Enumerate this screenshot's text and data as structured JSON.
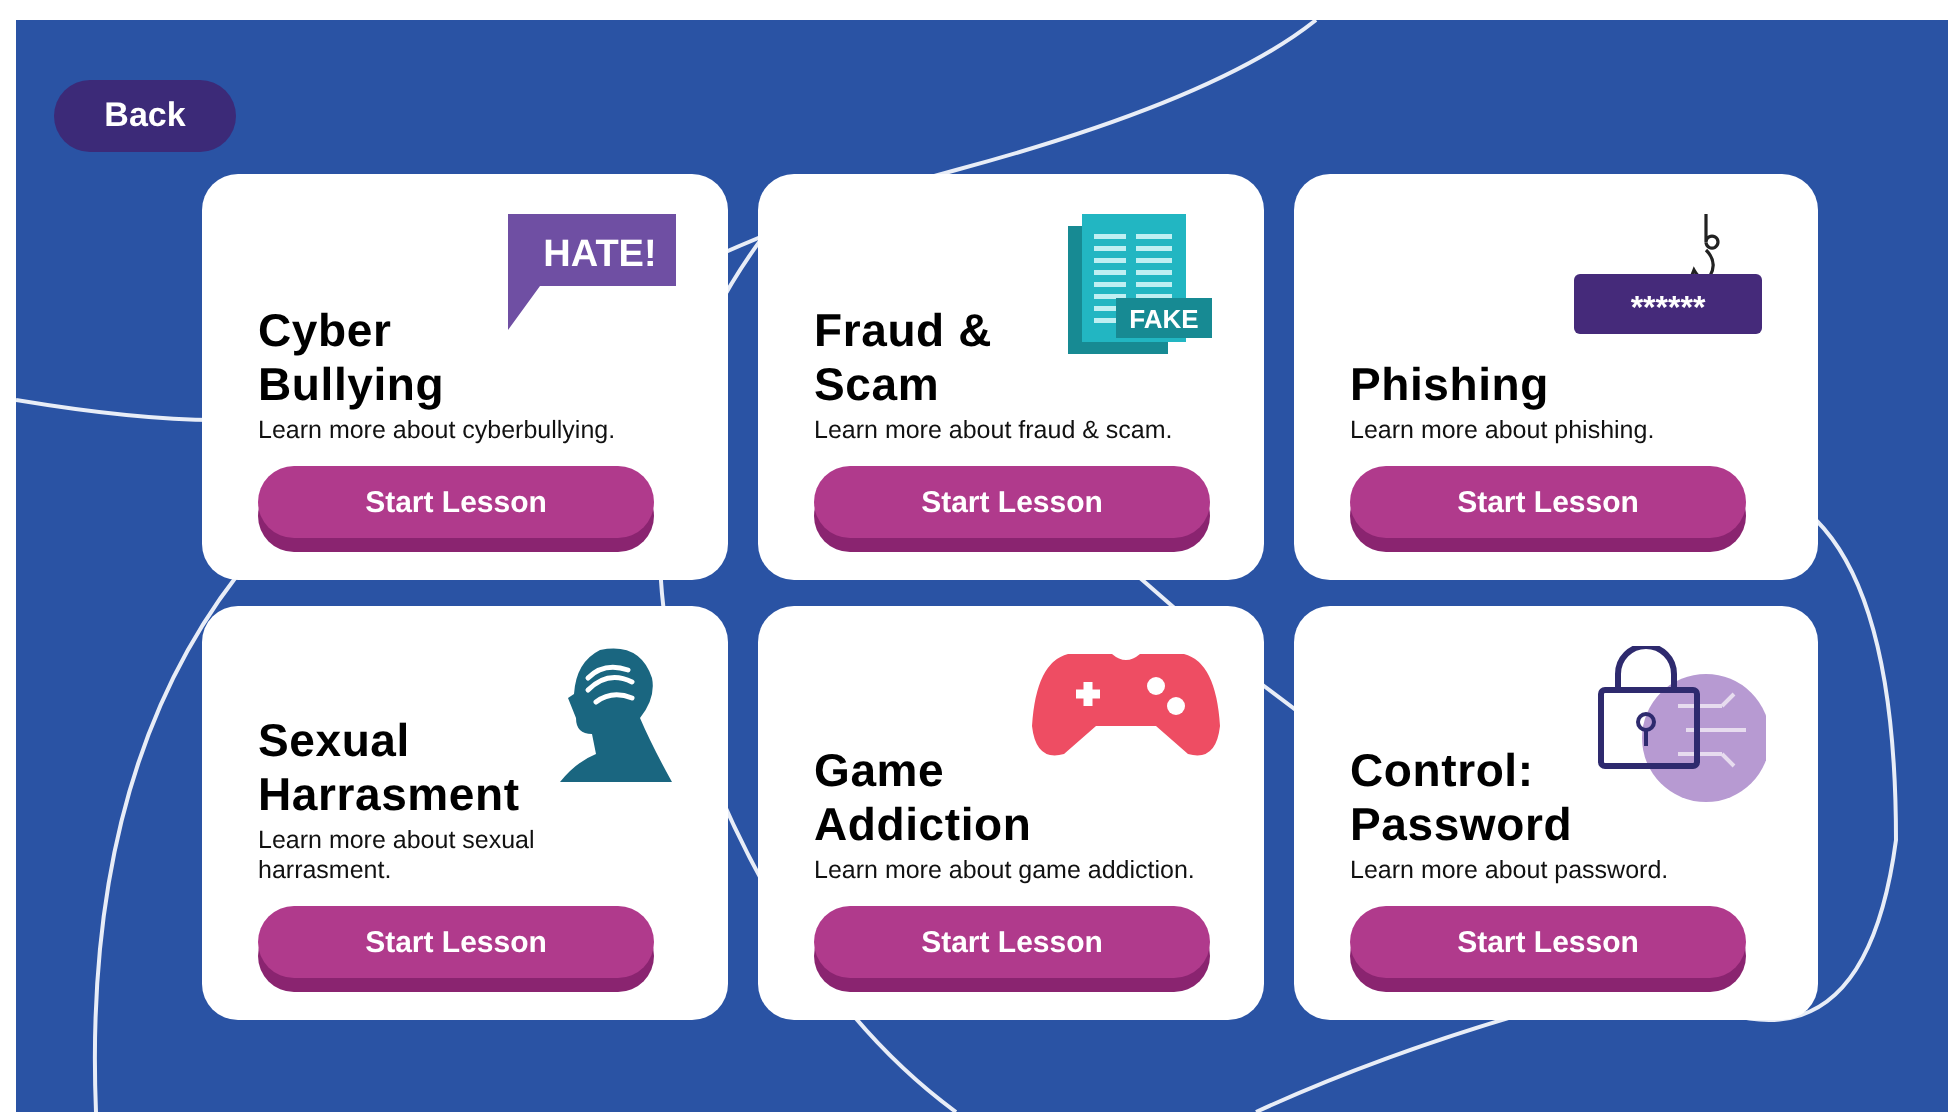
{
  "back_button": "Back",
  "cards": [
    {
      "title": "Cyber\nBullying",
      "description": "Learn more about cyberbullying.",
      "button": "Start Lesson",
      "icon": {
        "kind": "bubble",
        "text": "HATE!"
      }
    },
    {
      "title": "Fraud &\nScam",
      "description": "Learn more about fraud & scam.",
      "button": "Start Lesson",
      "icon": {
        "kind": "document",
        "text": "FAKE"
      }
    },
    {
      "title": "Phishing",
      "description": "Learn more about phishing.",
      "button": "Start Lesson",
      "icon": {
        "kind": "hook",
        "text": "******"
      }
    },
    {
      "title": "Sexual\nHarrasment",
      "description": "Learn more about sexual\nharrasment.",
      "button": "Start Lesson",
      "icon": {
        "kind": "head"
      }
    },
    {
      "title": "Game\nAddiction",
      "description": "Learn more about game addiction.",
      "button": "Start Lesson",
      "icon": {
        "kind": "gamepad"
      }
    },
    {
      "title": "Control:\nPassword",
      "description": "Learn more about password.",
      "button": "Start Lesson",
      "icon": {
        "kind": "padlock"
      }
    }
  ]
}
